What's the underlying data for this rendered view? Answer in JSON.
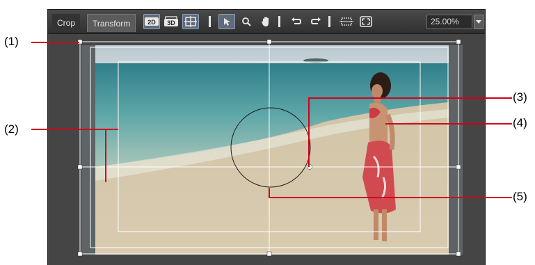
{
  "toolbar": {
    "tabs": [
      {
        "label": "Crop",
        "active": false
      },
      {
        "label": "Transform",
        "active": true
      }
    ],
    "buttons": [
      {
        "icon": "2d-mode-icon"
      },
      {
        "icon": "3d-mode-icon"
      },
      {
        "icon": "grid-icon"
      },
      {
        "icon": "select-arrow-icon"
      },
      {
        "icon": "zoom-icon"
      },
      {
        "icon": "hand-pan-icon"
      },
      {
        "icon": "undo-icon"
      },
      {
        "icon": "redo-icon"
      },
      {
        "icon": "fit-frame-icon"
      },
      {
        "icon": "fullscreen-icon"
      }
    ],
    "zoom_value": "25.00%"
  },
  "preview": {
    "scene": "beach photo with person in red swimsuit"
  },
  "callouts": [
    "(1)",
    "(2)",
    "(3)",
    "(4)",
    "(5)"
  ],
  "colors": {
    "panel_bg": "#3a3a3a",
    "toolbar_bg": "#3c3c3c",
    "guide_white": "#ffffff",
    "callout_red": "#d0021b"
  }
}
